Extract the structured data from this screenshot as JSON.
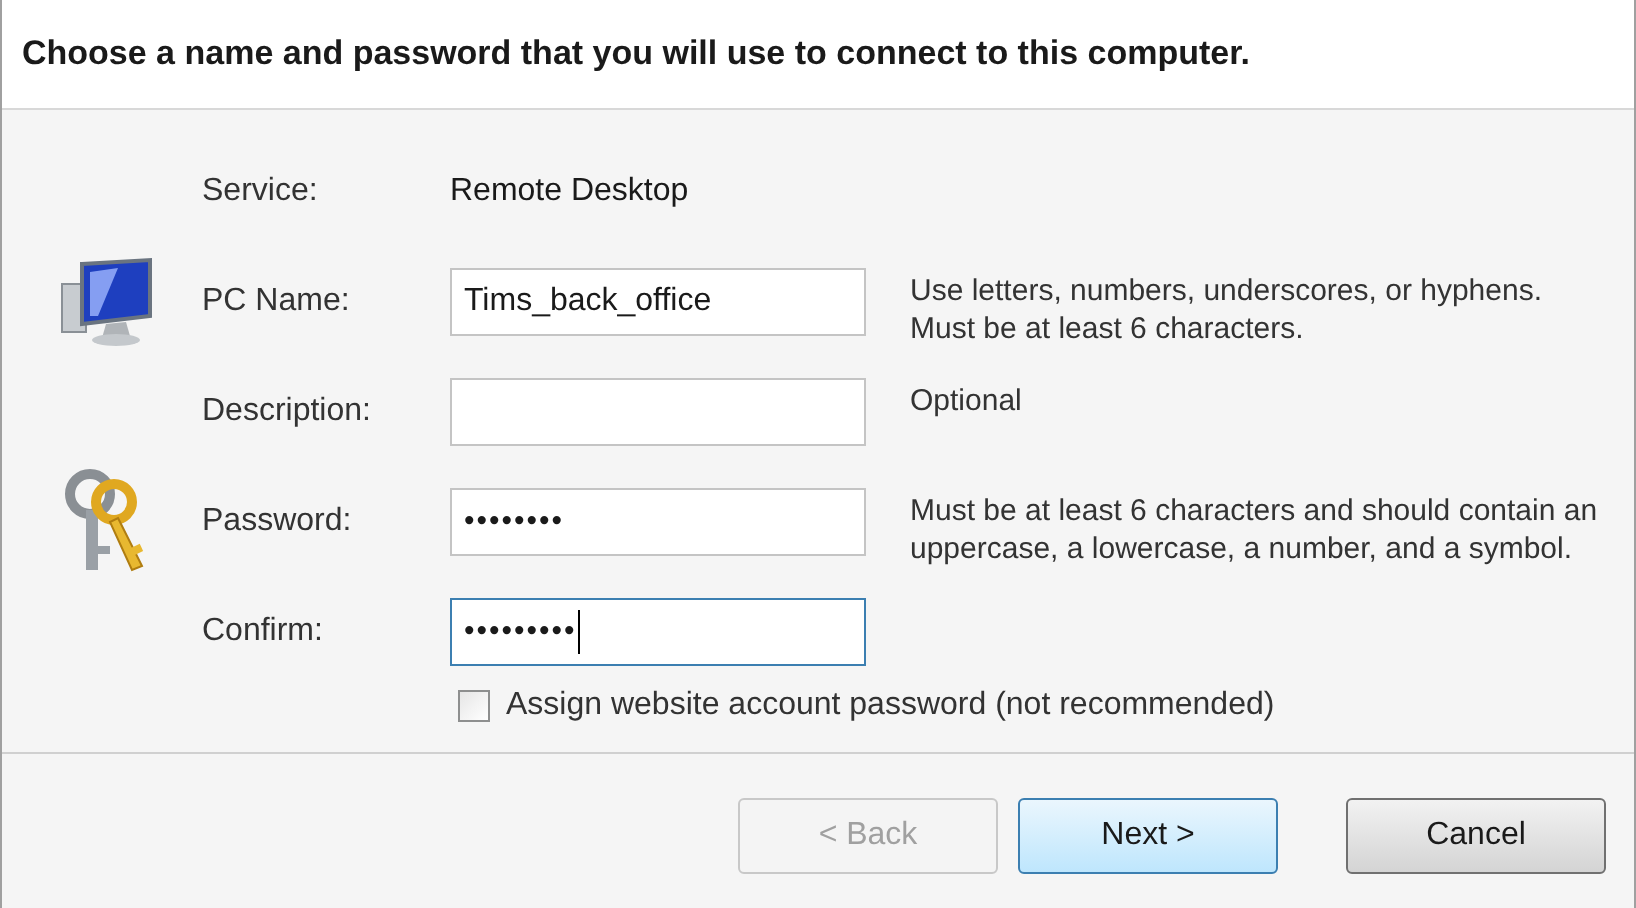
{
  "header": {
    "title": "Choose a name and password that you will use to connect to this computer."
  },
  "fields": [
    {
      "kind": "static",
      "label": "Service:",
      "value": "Remote Desktop"
    },
    {
      "kind": "text",
      "label": "PC Name:",
      "value": "Tims_back_office",
      "focused": false,
      "hint": "Use letters, numbers, underscores, or hyphens. Must be at least 6 characters."
    },
    {
      "kind": "text",
      "label": "Description:",
      "focused": false,
      "hint": "Optional"
    },
    {
      "kind": "password",
      "label": "Password:",
      "value": "••••••••",
      "focused": false,
      "hint": "Must be at least 6 characters and should contain an uppercase, a lowercase, a number, and a symbol."
    },
    {
      "kind": "password",
      "label": "Confirm:",
      "value": "•••••••••",
      "focused": true
    }
  ],
  "checkbox": {
    "label": "Assign website account password (not recommended)",
    "checked": false
  },
  "buttons": [
    {
      "label": "< Back",
      "disabled": true,
      "default": false
    },
    {
      "label": "Next >",
      "disabled": false,
      "default": true
    },
    {
      "label": "Cancel",
      "disabled": false,
      "default": false
    }
  ]
}
